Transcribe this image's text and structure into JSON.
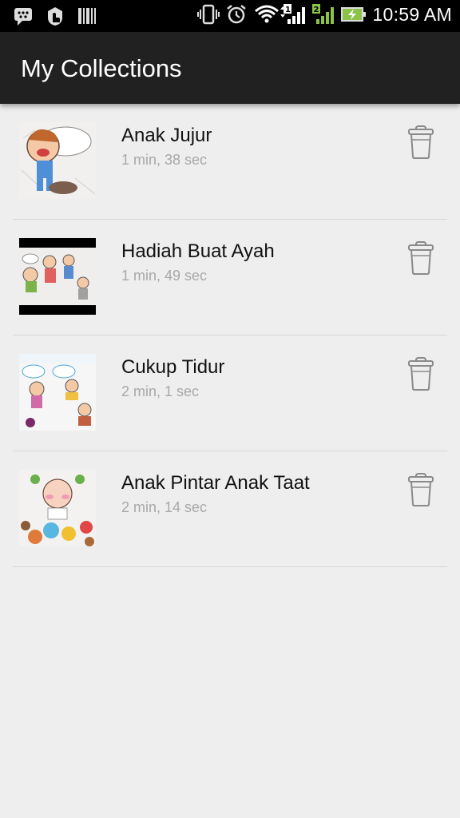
{
  "status_bar": {
    "time": "10:59 AM",
    "icons_left": [
      "bbm-icon",
      "touch-icon",
      "barcode-icon"
    ],
    "icons_right": [
      "vibrate-icon",
      "alarm-icon",
      "wifi-icon",
      "sim1-signal-icon",
      "sim2-signal-icon",
      "battery-charging-icon"
    ]
  },
  "action_bar": {
    "title": "My Collections"
  },
  "collections": [
    {
      "title": "Anak Jujur",
      "duration": "1 min, 38 sec"
    },
    {
      "title": "Hadiah Buat Ayah",
      "duration": "1 min, 49 sec"
    },
    {
      "title": "Cukup Tidur",
      "duration": "2 min, 1 sec"
    },
    {
      "title": "Anak Pintar Anak Taat",
      "duration": "2 min, 14 sec"
    }
  ],
  "colors": {
    "action_bar": "#212121",
    "background": "#eeeeee",
    "battery": "#8bc34a"
  }
}
